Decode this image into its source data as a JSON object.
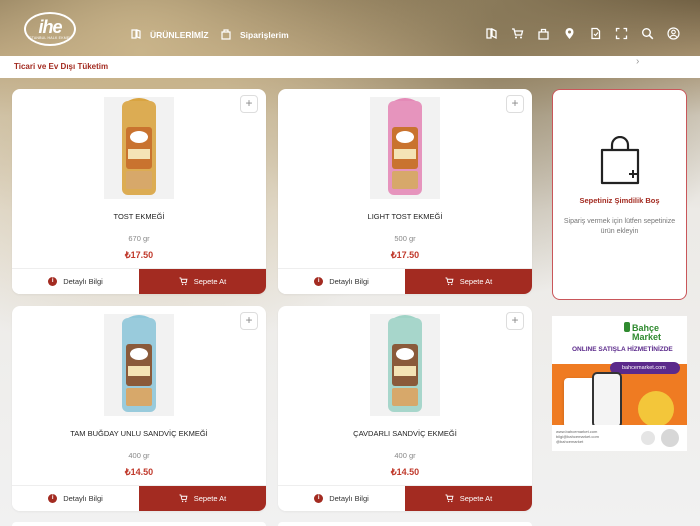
{
  "brand": {
    "logo_text": "ihe",
    "logo_subtitle": "İSTANBUL HALK EKMEK"
  },
  "nav": {
    "products_label": "ÜRÜNLERİMİZ",
    "orders_label": "Siparişlerim",
    "icons": [
      "menu-icon",
      "cart-icon",
      "bag-icon",
      "location-icon",
      "document-icon",
      "fullscreen-icon",
      "search-icon",
      "user-icon"
    ]
  },
  "breadcrumb": {
    "label": "Ticari ve Ev Dışı Tüketim"
  },
  "products": [
    {
      "name": "TOST EKMEĞİ",
      "weight": "670 gr",
      "price": "₺17.50",
      "label_text": "TOST",
      "bag_color": "#d9a441",
      "accent": "#c9732f"
    },
    {
      "name": "LIGHT TOST EKMEĞİ",
      "weight": "500 gr",
      "price": "₺17.50",
      "label_text": "TOST",
      "bag_color": "#e48ab7",
      "accent": "#c9732f"
    },
    {
      "name": "TAM BUĞDAY UNLU SANDVİÇ EKMEĞİ",
      "weight": "400 gr",
      "price": "₺14.50",
      "label_text": "TAM BUĞDAY UNLU SANDVİÇ",
      "bag_color": "#8fc7d9",
      "accent": "#8a5a3a"
    },
    {
      "name": "ÇAVDARLI SANDVİÇ EKMEĞİ",
      "weight": "400 gr",
      "price": "₺14.50",
      "label_text": "ÇAVDARLI SANDVİÇ EKMEĞİ",
      "bag_color": "#9fd3c6",
      "accent": "#8a5a3a"
    }
  ],
  "actions": {
    "detail_label": "Detaylı Bilgi",
    "cart_label": "Sepete At",
    "add_symbol": "+"
  },
  "cart": {
    "title": "Sepetiniz Şimdilik Boş",
    "description": "Sipariş vermek için lütfen sepetinize ürün ekleyin"
  },
  "ad": {
    "brand": "Bahçe Market",
    "headline": "ONLINE SATIŞLA HİZMETİNİZDE",
    "url": "bahcemarket.com",
    "social": "www.bahcemarket.com\nbilgi@bahcemarket.com\n@bahcemarket"
  },
  "colors": {
    "accent": "#a32b21",
    "price": "#c0392b"
  }
}
